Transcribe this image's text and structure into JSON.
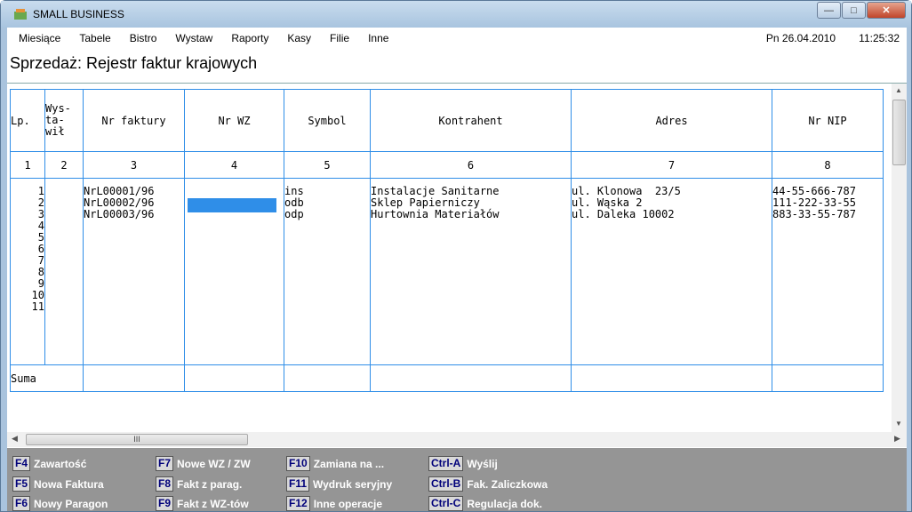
{
  "window": {
    "title": "SMALL BUSINESS"
  },
  "menu": {
    "items": [
      {
        "label": "Miesiące"
      },
      {
        "label": "Tabele"
      },
      {
        "label": "Bistro"
      },
      {
        "label": "Wystaw"
      },
      {
        "label": "Raporty"
      },
      {
        "label": "Kasy"
      },
      {
        "label": "Filie"
      },
      {
        "label": "Inne"
      }
    ],
    "date": "Pn 26.04.2010",
    "time": "11:25:32"
  },
  "page": {
    "title": "Sprzedaż: Rejestr faktur krajowych"
  },
  "table": {
    "headers": [
      "Lp.",
      "Wys-ta-wił",
      "Nr faktury",
      "Nr WZ",
      "Symbol",
      "Kontrahent",
      "Adres",
      "Nr NIP"
    ],
    "wys_lines": [
      "Wys-",
      "ta-",
      "wił"
    ],
    "col_numbers": [
      "1",
      "2",
      "3",
      "4",
      "5",
      "6",
      "7",
      "8"
    ],
    "lp": [
      "1",
      "2",
      "3",
      "4",
      "5",
      "6",
      "7",
      "8",
      "9",
      "10",
      "11"
    ],
    "rows": [
      {
        "faktura": "NrL00001/96",
        "symbol": "ins",
        "kontrahent": "Instalacje Sanitarne",
        "adres": "ul. Klonowa  23/5",
        "nip": "44-55-666-787"
      },
      {
        "faktura": "NrL00002/96",
        "symbol": "odb",
        "kontrahent": "Sklep Papierniczy",
        "adres": "ul. Wąska 2",
        "nip": "111-222-33-55"
      },
      {
        "faktura": "NrL00003/96",
        "symbol": "odp",
        "kontrahent": "Hurtownia Materiałów",
        "adres": "ul. Daleka 10002",
        "nip": "883-33-55-787"
      }
    ],
    "suma_label": "Suma"
  },
  "fkeys": [
    {
      "key": "F4",
      "label": "Zawartość"
    },
    {
      "key": "F5",
      "label": "Nowa Faktura"
    },
    {
      "key": "F6",
      "label": "Nowy Paragon"
    },
    {
      "key": "F7",
      "label": "Nowe WZ / ZW"
    },
    {
      "key": "F8",
      "label": "Fakt z parag."
    },
    {
      "key": "F9",
      "label": "Fakt z WZ-tów"
    },
    {
      "key": "F10",
      "label": "Zamiana na ..."
    },
    {
      "key": "F11",
      "label": "Wydruk seryjny"
    },
    {
      "key": "F12",
      "label": "Inne operacje"
    },
    {
      "key": "Ctrl-A",
      "label": "Wyślij"
    },
    {
      "key": "Ctrl-B",
      "label": "Fak. Zaliczkowa"
    },
    {
      "key": "Ctrl-C",
      "label": "Regulacja dok."
    }
  ],
  "scrollbar": {
    "thumb_glyph": "III"
  },
  "colors": {
    "grid": "#2f8ee8",
    "fkey_panel": "#959595",
    "key_text": "#00007a"
  }
}
